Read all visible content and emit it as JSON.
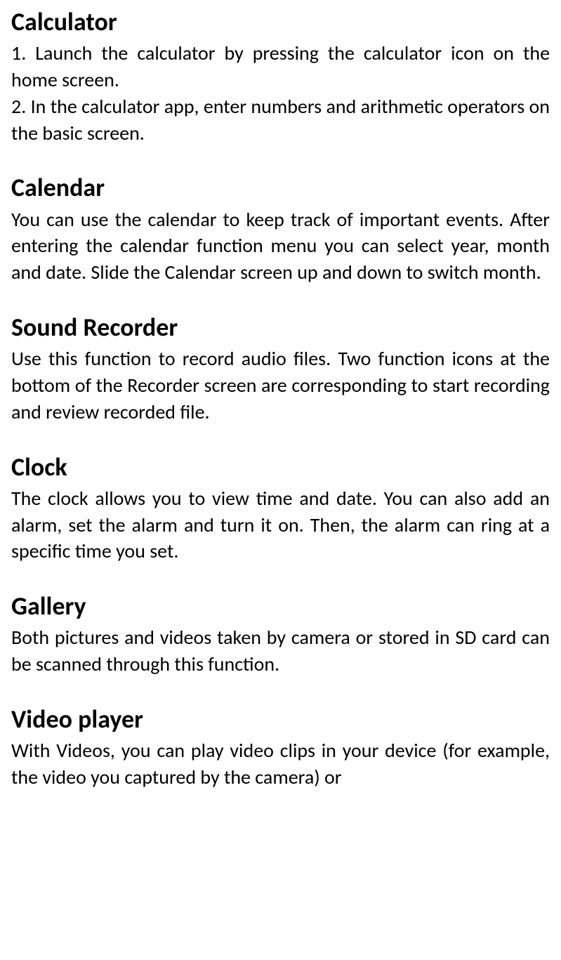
{
  "sections": [
    {
      "heading": "Calculator",
      "body": "1. Launch the calculator by pressing the calculator icon on the home screen.\n2. In the calculator app, enter numbers and arithmetic operators on the basic screen."
    },
    {
      "heading": "Calendar",
      "body": "You can use the calendar to keep track of important events. After entering the calendar function menu you can select year, month and date. Slide the Calendar screen up and down to switch month."
    },
    {
      "heading": "Sound Recorder",
      "body": "Use this function to record audio files. Two function icons at the bottom of the Recorder screen are corresponding to start recording and review recorded file."
    },
    {
      "heading": "Clock",
      "body": "The clock allows you to view time and date. You can also add an alarm, set the alarm and turn it on. Then, the alarm can ring at a specific time you set."
    },
    {
      "heading": "Gallery",
      "body": "Both pictures and videos taken by camera or stored in SD card can be scanned through this function."
    },
    {
      "heading": "Video player",
      "body": "With Videos, you can play video clips in your device (for example, the video you captured by the camera) or"
    }
  ]
}
